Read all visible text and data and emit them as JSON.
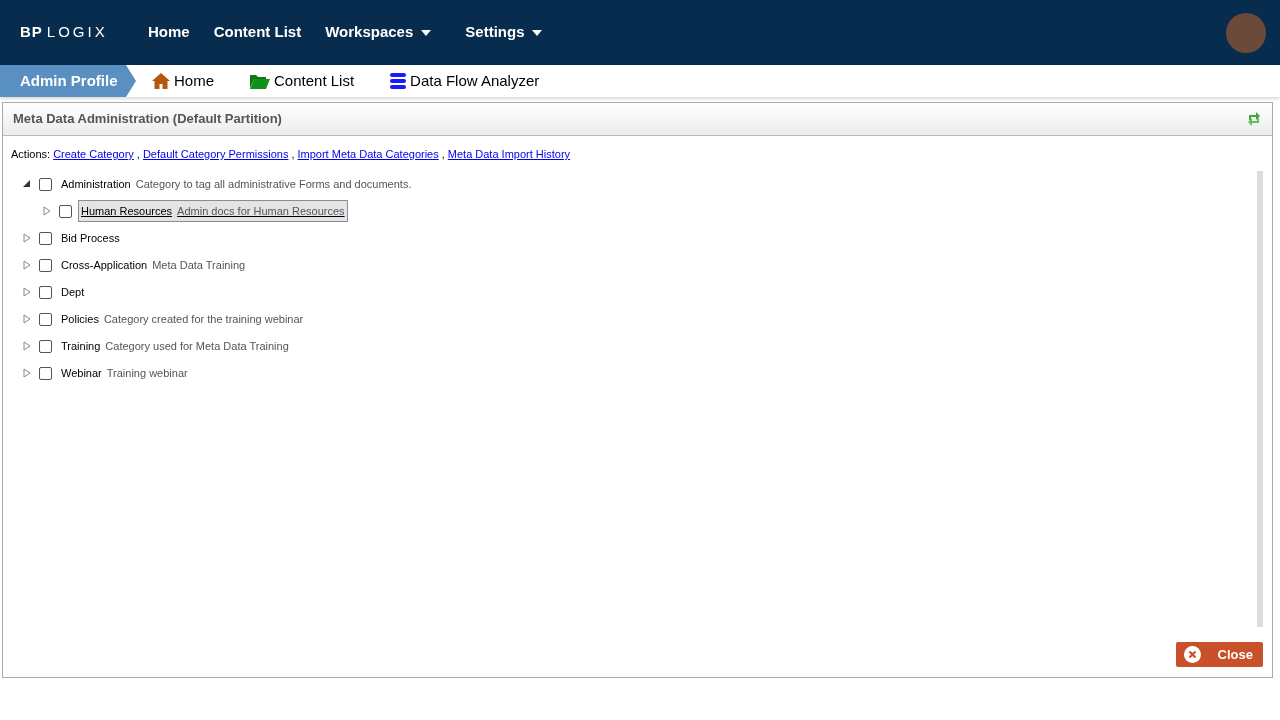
{
  "logo": {
    "left": "BP",
    "right": "LOGIX"
  },
  "nav": [
    {
      "label": "Home",
      "dropdown": false
    },
    {
      "label": "Content List",
      "dropdown": false
    },
    {
      "label": "Workspaces",
      "dropdown": true
    },
    {
      "label": "Settings",
      "dropdown": true
    }
  ],
  "breadcrumb": {
    "profile": "Admin Profile",
    "links": [
      {
        "label": "Home",
        "kind": "home"
      },
      {
        "label": "Content List",
        "kind": "folder"
      },
      {
        "label": "Data Flow Analyzer",
        "kind": "database"
      }
    ]
  },
  "panel": {
    "title": "Meta Data Administration (Default Partition)",
    "actions_label": "Actions:",
    "actions_separator": ",",
    "actions": [
      "Create Category",
      "Default Category Permissions",
      "Import Meta Data Categories",
      "Meta Data Import History"
    ],
    "tree": [
      {
        "name": "Administration",
        "description": "Category to tag all administrative Forms and documents.",
        "expanded": true,
        "checked": false,
        "selected": false,
        "children": [
          {
            "name": "Human Resources",
            "description": "Admin docs for Human Resources",
            "expanded": false,
            "checked": false,
            "selected": true
          }
        ]
      },
      {
        "name": "Bid Process",
        "expanded": false,
        "checked": false,
        "selected": false
      },
      {
        "name": "Cross-Application",
        "description": "Meta Data Training",
        "expanded": false,
        "checked": false,
        "selected": false
      },
      {
        "name": "Dept",
        "expanded": false,
        "checked": false,
        "selected": false
      },
      {
        "name": "Policies",
        "description": "Category created for the training webinar",
        "expanded": false,
        "checked": false,
        "selected": false
      },
      {
        "name": "Training",
        "description": "Category used for Meta Data Training",
        "expanded": false,
        "checked": false,
        "selected": false
      },
      {
        "name": "Webinar",
        "description": "Training webinar",
        "expanded": false,
        "checked": false,
        "selected": false
      }
    ],
    "close_button": "Close"
  }
}
